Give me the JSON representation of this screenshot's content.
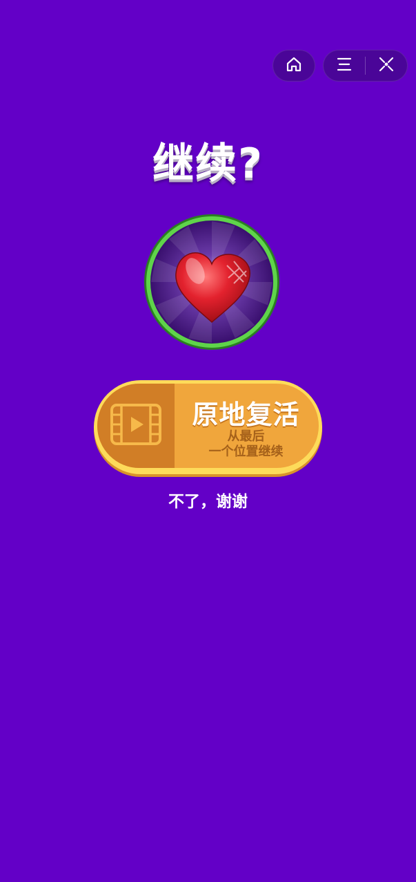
{
  "title": "继续?",
  "revive": {
    "main_label": "原地复活",
    "sub_line1": "从最后",
    "sub_line2": "一个位置继续"
  },
  "decline_label": "不了，谢谢",
  "icons": {
    "home": "home-icon",
    "menu": "menu-icon",
    "close": "close-icon",
    "video": "video-icon",
    "heart": "heart-icon"
  },
  "colors": {
    "background": "#6300c7",
    "capsule": "#4a0598",
    "badge_ring": "#5fd44a",
    "button_face": "#f0a63c",
    "button_left": "#d17e26",
    "button_rim": "#fddb5a",
    "heart": "#e3222e"
  }
}
